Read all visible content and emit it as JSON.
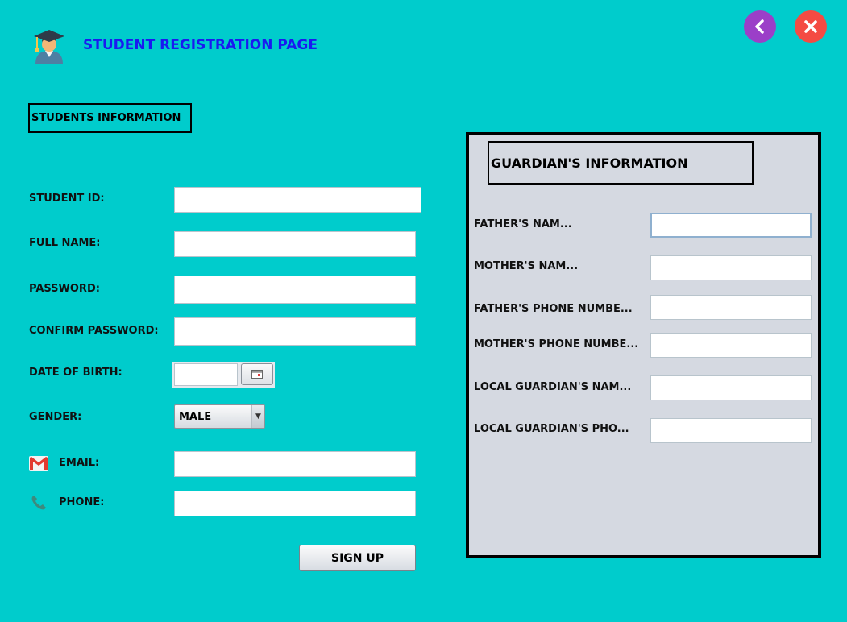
{
  "header": {
    "title": "STUDENT REGISTRATION PAGE",
    "avatar_icon": "student-graduate-icon",
    "back_icon": "chevron-left-icon",
    "close_icon": "close-icon"
  },
  "colors": {
    "background": "#00cccc",
    "title": "#1a1af0",
    "back_button": "#9b3fc8",
    "close_button": "#f44b43",
    "guardian_panel": "#d5d9e1"
  },
  "student_section": {
    "title": "STUDENTS INFORMATION",
    "labels": {
      "student_id": "STUDENT ID:",
      "full_name": "FULL NAME:",
      "password": "PASSWORD:",
      "confirm_password": "CONFIRM PASSWORD:",
      "dob": "DATE OF BIRTH:",
      "gender": "GENDER:",
      "email": "EMAIL:",
      "phone": "PHONE:"
    },
    "values": {
      "student_id": "",
      "full_name": "",
      "password": "",
      "confirm_password": "",
      "dob": "",
      "email": "",
      "phone": ""
    },
    "gender_selected": "MALE",
    "signup_label": "SIGN UP"
  },
  "guardian_section": {
    "title": "GUARDIAN'S INFORMATION",
    "labels": {
      "father_name": "FATHER'S NAM...",
      "mother_name": "MOTHER'S NAM...",
      "father_phone": "FATHER'S PHONE NUMBE...",
      "mother_phone": "MOTHER'S PHONE NUMBE...",
      "local_name": "LOCAL GUARDIAN'S NAM...",
      "local_phone": "LOCAL GUARDIAN'S PHO..."
    },
    "values": {
      "father_name": "",
      "mother_name": "",
      "father_phone": "",
      "mother_phone": "",
      "local_name": "",
      "local_phone": ""
    }
  }
}
